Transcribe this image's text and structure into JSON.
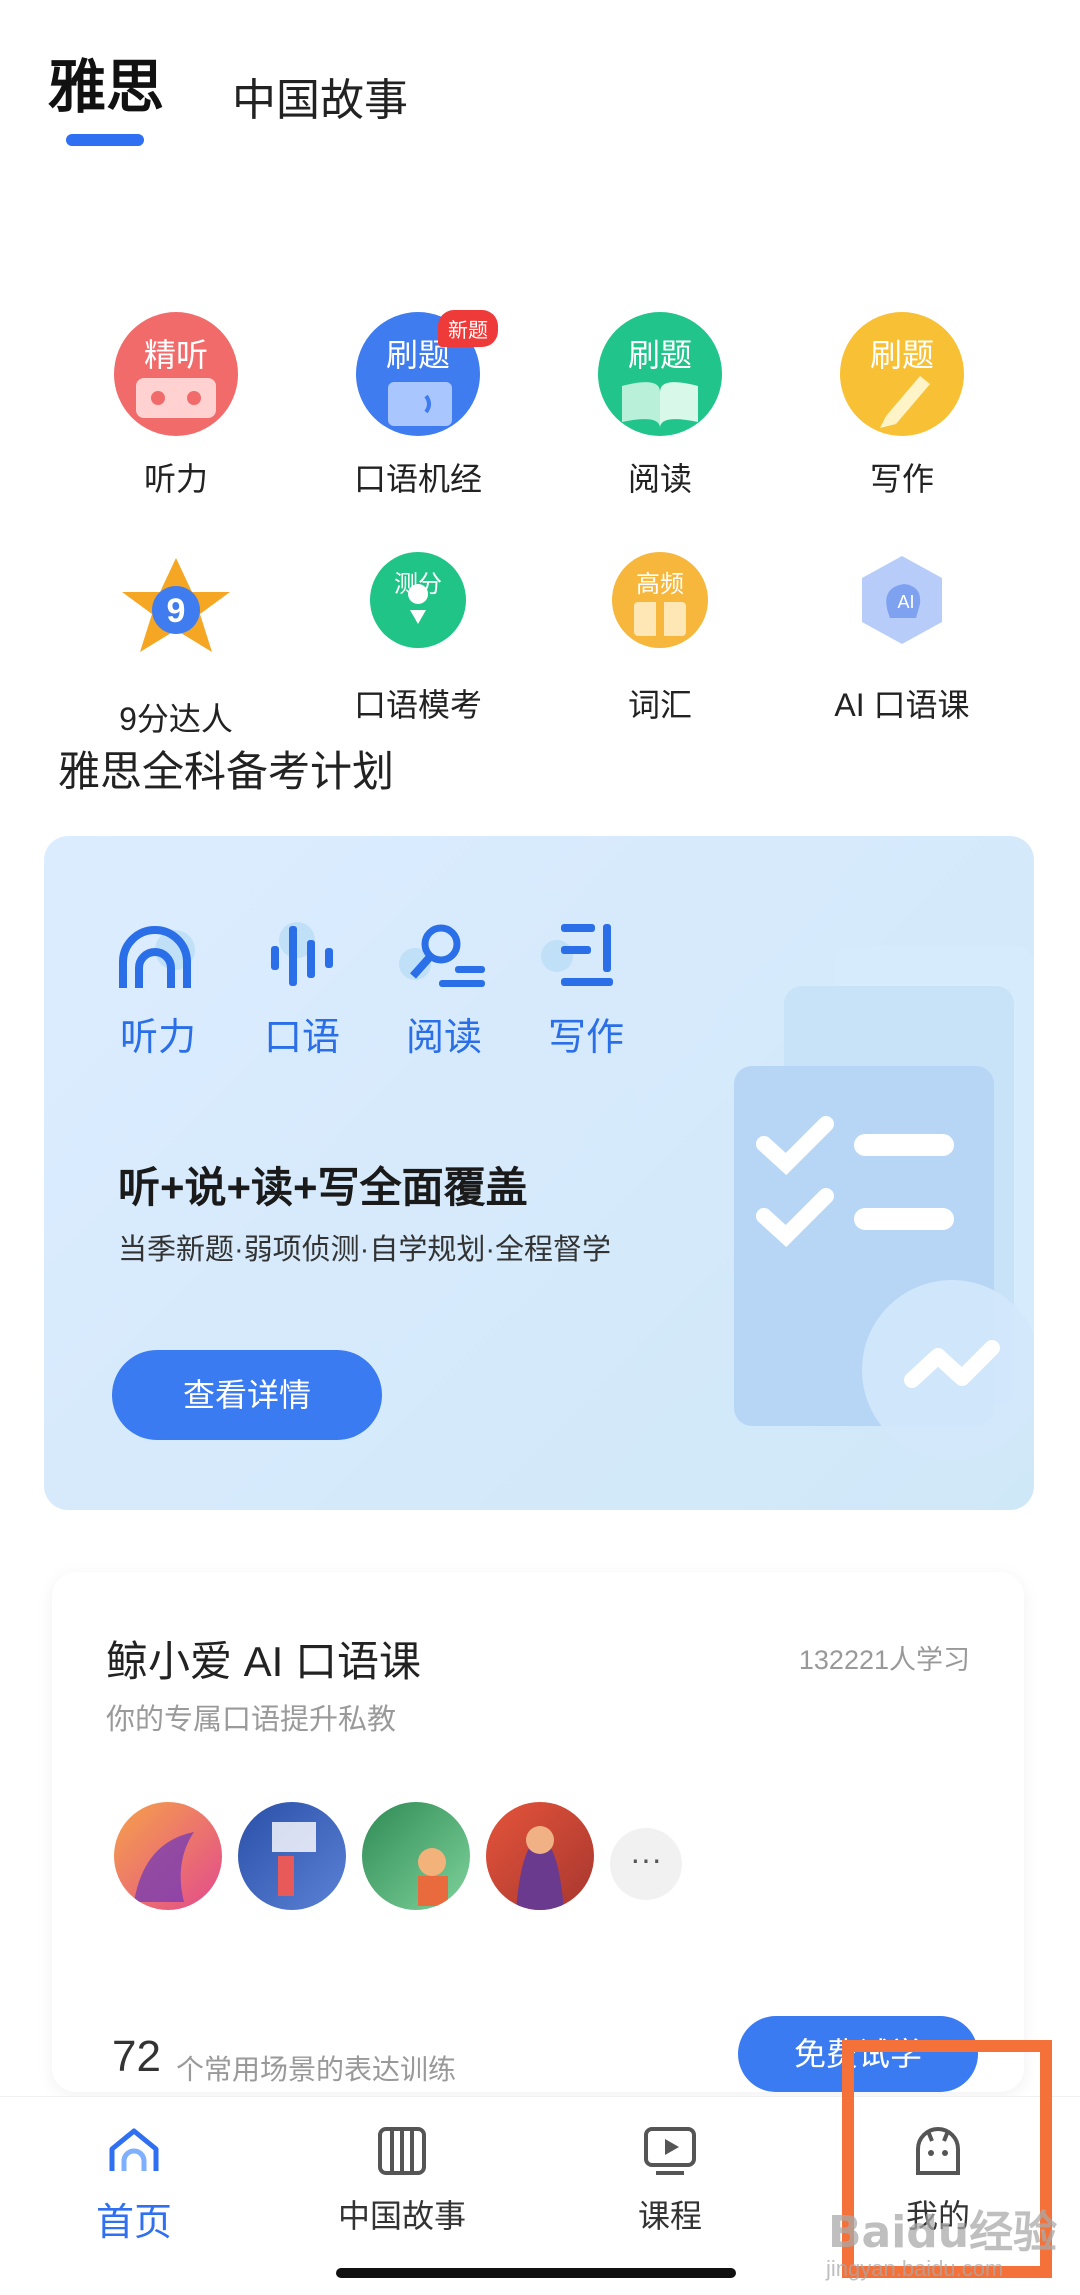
{
  "top_tabs": {
    "active": "雅思",
    "second": "中国故事"
  },
  "grid": [
    {
      "icon_label": "精听",
      "label": "听力",
      "icon": "listening-icon",
      "color": "#f26b6b"
    },
    {
      "icon_label": "刷题",
      "label": "口语机经",
      "icon": "speaking-machine-icon",
      "color": "#3f7cf0",
      "badge": "新题"
    },
    {
      "icon_label": "刷题",
      "label": "阅读",
      "icon": "reading-icon",
      "color": "#21c48a"
    },
    {
      "icon_label": "刷题",
      "label": "写作",
      "icon": "writing-icon",
      "color": "#f8c035"
    },
    {
      "icon_label": "9",
      "label": "9分达人",
      "icon": "star-nine-icon",
      "color": "#f5a623"
    },
    {
      "icon_label": "测分",
      "label": "口语模考",
      "icon": "mock-test-icon",
      "color": "#1fc486"
    },
    {
      "icon_label": "高频",
      "label": "词汇",
      "icon": "vocabulary-icon",
      "color": "#f6b73c"
    },
    {
      "icon_label": "AI",
      "label": "AI  口语课",
      "icon": "ai-course-icon",
      "color": "#8fb0f5"
    }
  ],
  "section_title": "雅思全科备考计划",
  "plan": {
    "subjects": [
      "听力",
      "口语",
      "阅读",
      "写作"
    ],
    "headline": "听+说+读+写全面覆盖",
    "subtitle": "当季新题·弱项侦测·自学规划·全程督学",
    "button": "查看详情"
  },
  "ai_course": {
    "title": "鲸小爱 AI 口语课",
    "learners": "132221人学习",
    "subtitle": "你的专属口语提升私教",
    "more": "···",
    "scene_count": "72",
    "scene_text": "个常用场景的表达训练",
    "button": "免费试学"
  },
  "bottom_nav": [
    {
      "label": "首页",
      "icon": "home-icon",
      "active": true
    },
    {
      "label": "中国故事",
      "icon": "china-story-icon",
      "active": false
    },
    {
      "label": "课程",
      "icon": "course-play-icon",
      "active": false
    },
    {
      "label": "我的",
      "icon": "profile-icon",
      "active": false
    }
  ],
  "watermark": {
    "text": "Baidu经验",
    "url": "jingyan.baidu.com"
  }
}
